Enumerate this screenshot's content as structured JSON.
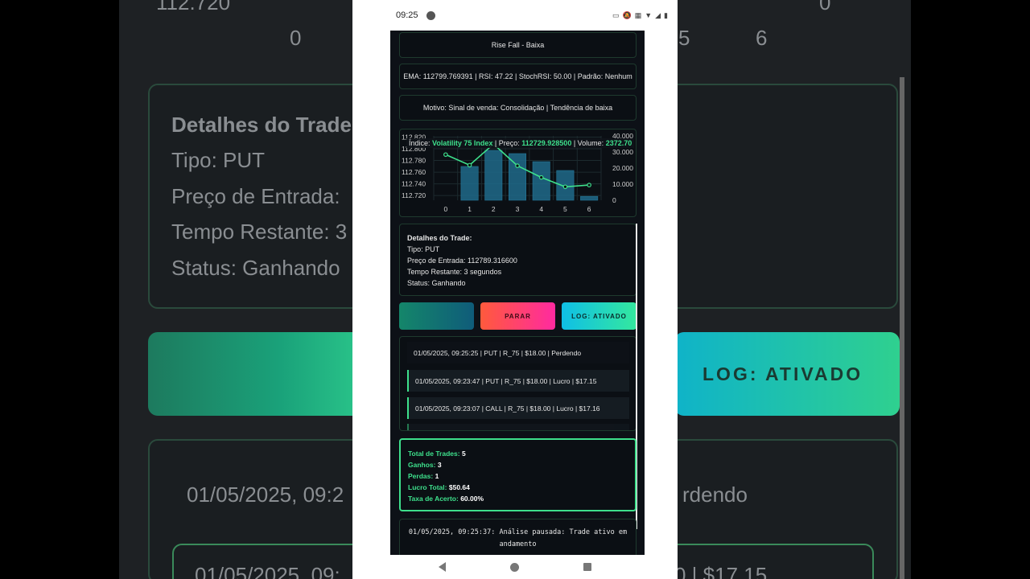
{
  "status_bar": {
    "time": "09:25"
  },
  "signal": {
    "text": "Rise Fall - Baixa"
  },
  "indicators": {
    "text": "EMA: 112799.769391 | RSI: 47.22 | StochRSI: 50.00 | Padrão: Nenhum"
  },
  "reason": {
    "text": "Motivo: Sinal de venda: Consolidação | Tendência de baixa"
  },
  "tooltip": {
    "index_label": "Índice: ",
    "index_value": "Volatility 75 Index",
    "price_label": " | Preço: ",
    "price_value": "112729.928500",
    "volume_label": " | Volume: ",
    "volume_value": "2372.70"
  },
  "chart_data": {
    "type": "bar+line",
    "x": [
      0,
      1,
      2,
      3,
      4,
      5,
      6
    ],
    "x_tick_labels": [
      "0",
      "1",
      "2",
      "3",
      "4",
      "5",
      "6"
    ],
    "y_left_tick_labels": [
      "112.720",
      "112.740",
      "112.760",
      "112.780",
      "112.800",
      "112.820"
    ],
    "y_right_tick_labels": [
      "0",
      "10.000",
      "20.000",
      "30.000",
      "40.000"
    ],
    "ylim_left": [
      112712,
      112822
    ],
    "ylim_right": [
      0,
      40000
    ],
    "series": [
      {
        "type": "line",
        "values": [
          112790,
          112772,
          112808,
          112771,
          112751,
          112735,
          112738
        ]
      },
      {
        "type": "bar",
        "values": [
          0,
          21000,
          31000,
          29000,
          24000,
          18500,
          2400
        ]
      }
    ],
    "grid": true,
    "colors": {
      "line": "#3ee08c",
      "bar": "#1f6a8a"
    }
  },
  "trade_details": {
    "title": "Detalhes do Trade:",
    "type": "Tipo: PUT",
    "entry": "Preço de Entrada: 112789.316600",
    "remaining": "Tempo Restante: 3 segundos",
    "status": "Status: Ganhando"
  },
  "buttons": {
    "start": "",
    "stop": "PARAR",
    "log": "LOG: ATIVADO"
  },
  "log": [
    {
      "text": "01/05/2025, 09:25:25 | PUT | R_75 | $18.00 | Perdendo",
      "kind": "plain"
    },
    {
      "text": "01/05/2025, 09:23:47 | PUT | R_75 | $18.00 | Lucro | $17.15",
      "kind": "win"
    },
    {
      "text": "01/05/2025, 09:23:07 | CALL | R_75 | $18.00 | Lucro | $17.16",
      "kind": "win"
    }
  ],
  "stats": {
    "total_label": "Total de Trades:",
    "total_value": "5",
    "wins_label": "Ganhos:",
    "wins_value": "3",
    "losses_label": "Perdas:",
    "losses_value": "1",
    "profit_label": "Lucro Total:",
    "profit_value": "$50.64",
    "rate_label": "Taxa de Acerto:",
    "rate_value": "60.00%"
  },
  "analysis": {
    "text": "01/05/2025, 09:25:37: Análise pausada: Trade ativo em andamento"
  },
  "background": {
    "tick_left_value": "112.720",
    "tick_0": "0",
    "tick_5": "5",
    "tick_6": "6",
    "tick_right_0": "0",
    "details_title": "Detalhes do Trade",
    "type": "Tipo: PUT",
    "entry": "Preço de Entrada:",
    "remaining": "Tempo Restante: 3",
    "status": "Status: Ganhando",
    "log_button": "LOG: ATIVADO",
    "log_date": "01/05/2025, 09:2",
    "log_tail": "rdendo",
    "log_date2": "01/05/2025, 09:",
    "log_tail2": "0 | $17.15"
  }
}
